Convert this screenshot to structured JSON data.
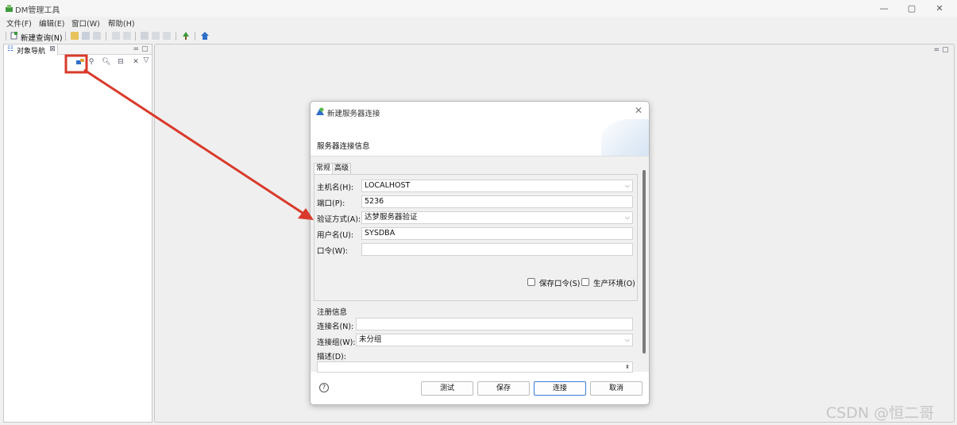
{
  "window": {
    "title": "DM管理工具",
    "controls": {
      "minimize": "—",
      "restore": "▢",
      "close": "✕"
    }
  },
  "menu": {
    "items": [
      "文件(F)",
      "编辑(E)",
      "窗口(W)",
      "帮助(H)"
    ]
  },
  "toolbar": {
    "new_query_label": "新建查询(N)"
  },
  "navigator": {
    "tab_label": "对象导航",
    "tab_close": "⊠",
    "panel_controls": "= ▢"
  },
  "editor": {
    "panel_controls": "= ▢"
  },
  "dialog": {
    "title": "新建服务器连接",
    "close": "✕",
    "header": "服务器连接信息",
    "tabs": [
      "常规",
      "高级"
    ],
    "host_label": "主机名(H):",
    "host_value": "LOCALHOST",
    "port_label": "端口(P):",
    "port_value": "5236",
    "auth_label": "验证方式(A):",
    "auth_value": "达梦服务器验证",
    "user_label": "用户名(U):",
    "user_value": "SYSDBA",
    "password_label": "口令(W):",
    "password_value": "",
    "save_password_label": "保存口令(S)",
    "production_env_label": "生产环境(O)",
    "register_section": "注册信息",
    "conn_name_label": "连接名(N):",
    "conn_name_value": "",
    "conn_group_label": "连接组(W):",
    "conn_group_value": "未分组",
    "desc_label": "描述(D):",
    "help": "?",
    "buttons": {
      "test": "测试",
      "save": "保存",
      "connect": "连接",
      "cancel": "取消"
    }
  },
  "annotation": {
    "color": "#d93a2b"
  },
  "watermark": "CSDN @恒二哥"
}
